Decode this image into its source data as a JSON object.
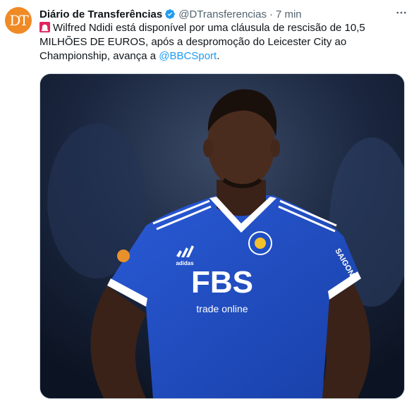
{
  "tweet": {
    "display_name": "Diário de Transferências",
    "handle": "@DTransferencias",
    "separator": "·",
    "time": "7 min",
    "avatar_text": "DT",
    "text_main": "Wilfred Ndidi está disponível por uma cláusula de rescisão de 10,5 MILHÕES DE EUROS, após a despromoção do Leicester City ao Championship, avança a ",
    "mention": "@BBCSport",
    "text_end": "."
  },
  "photo": {
    "jersey_sponsor": "FBS",
    "jersey_sponsor_sub": "trade online",
    "jersey_sleeve": "SAIGON",
    "kit_brand": "adidas"
  },
  "colors": {
    "avatar_bg": "#f08a24",
    "verified": "#1d9bf0",
    "link": "#1d9bf0",
    "jersey": "#1f4fc4"
  },
  "icons": [
    "siren-icon",
    "verified-badge-icon",
    "more-options-icon"
  ]
}
